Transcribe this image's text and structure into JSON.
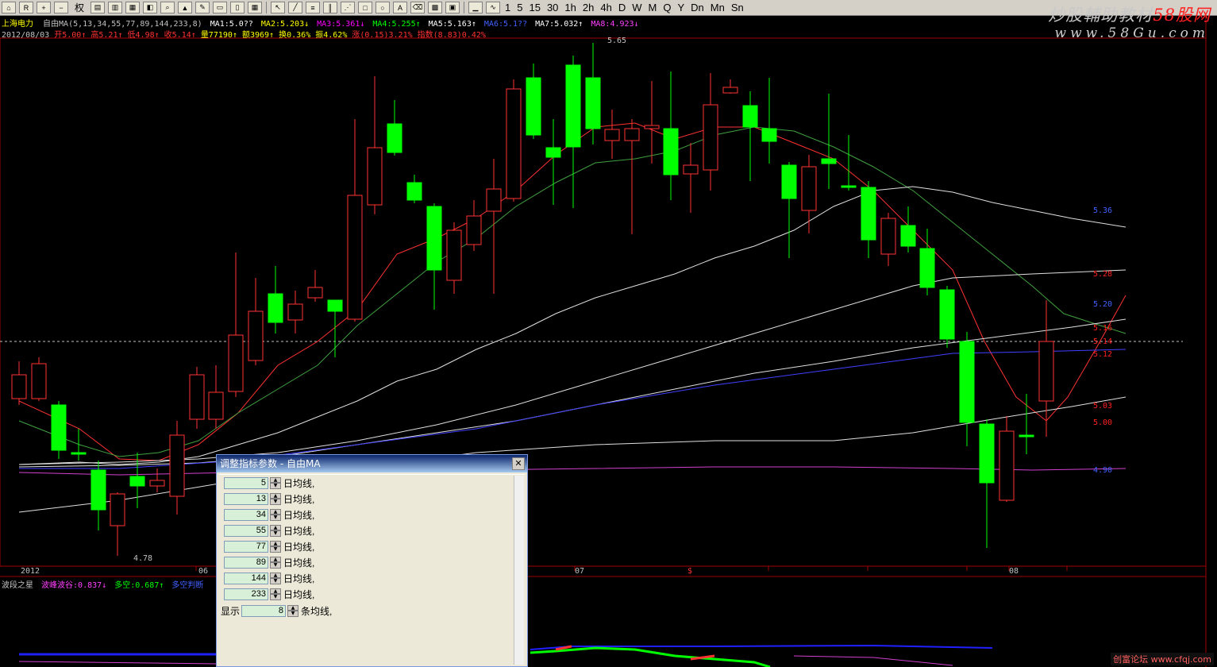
{
  "toolbar": {
    "quan_label": "权",
    "periods": [
      "1",
      "5",
      "15",
      "30",
      "1h",
      "2h",
      "4h",
      "D",
      "W",
      "M",
      "Q",
      "Y",
      "Dn",
      "Mn",
      "Sn"
    ]
  },
  "brand": {
    "prefix": "炒股輔助教材",
    "suffix": "58股网",
    "url": "www.58Gu.com"
  },
  "ma_line": {
    "stock": "上海电力",
    "indicator": "自由MA(5,13,34,55,77,89,144,233,8)",
    "ma1": "MA1:5.0??",
    "ma2": "MA2:5.203↓",
    "ma3": "MA3:5.361↓",
    "ma4": "MA4:5.255↑",
    "ma5": "MA5:5.163↑",
    "ma6": "MA6:5.1??",
    "ma7": "MA7:5.032↑",
    "ma8": "MA8:4.923↓"
  },
  "info_line": {
    "date": "2012/08/03",
    "open": "开5.00↑",
    "high": "高5.21↑",
    "low": "低4.98↑",
    "close": "收5.14↑",
    "volume": "量77190↑",
    "amount": "额3969↑",
    "turnover": "换0.36%",
    "amplitude": "振4.62%",
    "change": "涨(0.15)3.21%",
    "index": "指数(8.83)0.42%"
  },
  "price_labels": {
    "high": "5.65",
    "low": "4.78"
  },
  "right_labels": [
    {
      "text": "5.36",
      "color": "#4060ff"
    },
    {
      "text": "5.28",
      "color": "#ff2020"
    },
    {
      "text": "5.20",
      "color": "#4060ff"
    },
    {
      "text": "5.16",
      "color": "#ff2020"
    },
    {
      "text": "5.14",
      "color": "#ff2020"
    },
    {
      "text": "5.12",
      "color": "#ff2020"
    },
    {
      "text": "5.03",
      "color": "#ff2020"
    },
    {
      "text": "5.00",
      "color": "#ff2020"
    },
    {
      "text": "4.90",
      "color": "#4060ff"
    }
  ],
  "x_axis": {
    "year": "2012",
    "m06": "06",
    "m07": "07",
    "m08": "08",
    "marker": "$"
  },
  "indicator_line": {
    "name": "波段之星",
    "wave": "波峰波谷:0.837↓",
    "duokong": "多空:0.687↑",
    "extra": "多空判断"
  },
  "dialog": {
    "title": "调整指标参数 - 自由MA",
    "close": "✕",
    "suffix_label": "日均线,",
    "params": [
      "5",
      "13",
      "34",
      "55",
      "77",
      "89",
      "144",
      "233"
    ],
    "show_prefix": "显示",
    "show_value": "8",
    "show_suffix": "条均线,"
  },
  "watermark": "创富论坛 www.cfqj.com",
  "colors": {
    "up": "#ff3232",
    "down": "#00ff00",
    "bg": "#000000"
  }
}
